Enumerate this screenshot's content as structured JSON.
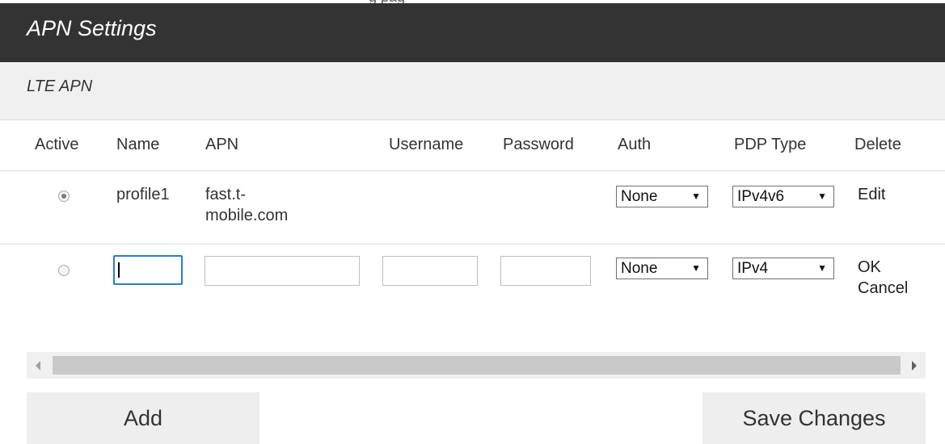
{
  "header": {
    "title": "APN Settings"
  },
  "section": {
    "label": "LTE APN"
  },
  "table": {
    "columns": [
      "Active",
      "Name",
      "APN",
      "Username",
      "Password",
      "Auth",
      "PDP Type",
      "Delete"
    ],
    "rows": [
      {
        "active": true,
        "name": "profile1",
        "apn_line1": "fast.t-",
        "apn_line2": "mobile.com",
        "auth": "None",
        "pdp": "IPv4v6",
        "action": "Edit"
      },
      {
        "active": false,
        "name": "",
        "apn": "",
        "username": "",
        "password": "",
        "auth": "None",
        "pdp": "IPv4",
        "action_ok": "OK",
        "action_cancel": "Cancel"
      }
    ]
  },
  "dropdown_arrow": "▼",
  "buttons": {
    "add": "Add",
    "save": "Save Changes"
  },
  "colors": {
    "title_bar": "#333333",
    "section_bg": "#f0f0f0",
    "focus": "#2b7cd3"
  }
}
